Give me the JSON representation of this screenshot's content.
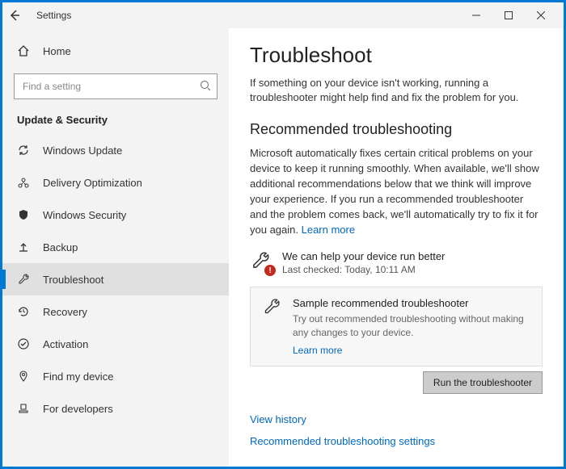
{
  "titlebar": {
    "title": "Settings"
  },
  "sidebar": {
    "home": "Home",
    "search_placeholder": "Find a setting",
    "category": "Update & Security",
    "items": [
      {
        "label": "Windows Update"
      },
      {
        "label": "Delivery Optimization"
      },
      {
        "label": "Windows Security"
      },
      {
        "label": "Backup"
      },
      {
        "label": "Troubleshoot"
      },
      {
        "label": "Recovery"
      },
      {
        "label": "Activation"
      },
      {
        "label": "Find my device"
      },
      {
        "label": "For developers"
      }
    ]
  },
  "content": {
    "title": "Troubleshoot",
    "intro": "If something on your device isn't working, running a troubleshooter might help find and fix the problem for you.",
    "rec_title": "Recommended troubleshooting",
    "rec_text": "Microsoft automatically fixes certain critical problems on your device to keep it running smoothly. When available, we'll show additional recommendations below that we think will improve your experience. If you run a recommended troubleshooter and the problem comes back, we'll automatically try to fix it for you again. ",
    "learn_more": "Learn more",
    "help_line1": "We can help your device run better",
    "help_line2": "Last checked: Today, 10:11 AM",
    "sample_title": "Sample recommended troubleshooter",
    "sample_desc": "Try out recommended troubleshooting without making any changes to your device.",
    "sample_link": "Learn more",
    "run_button": "Run the troubleshooter",
    "view_history": "View history",
    "rec_settings": "Recommended troubleshooting settings"
  }
}
